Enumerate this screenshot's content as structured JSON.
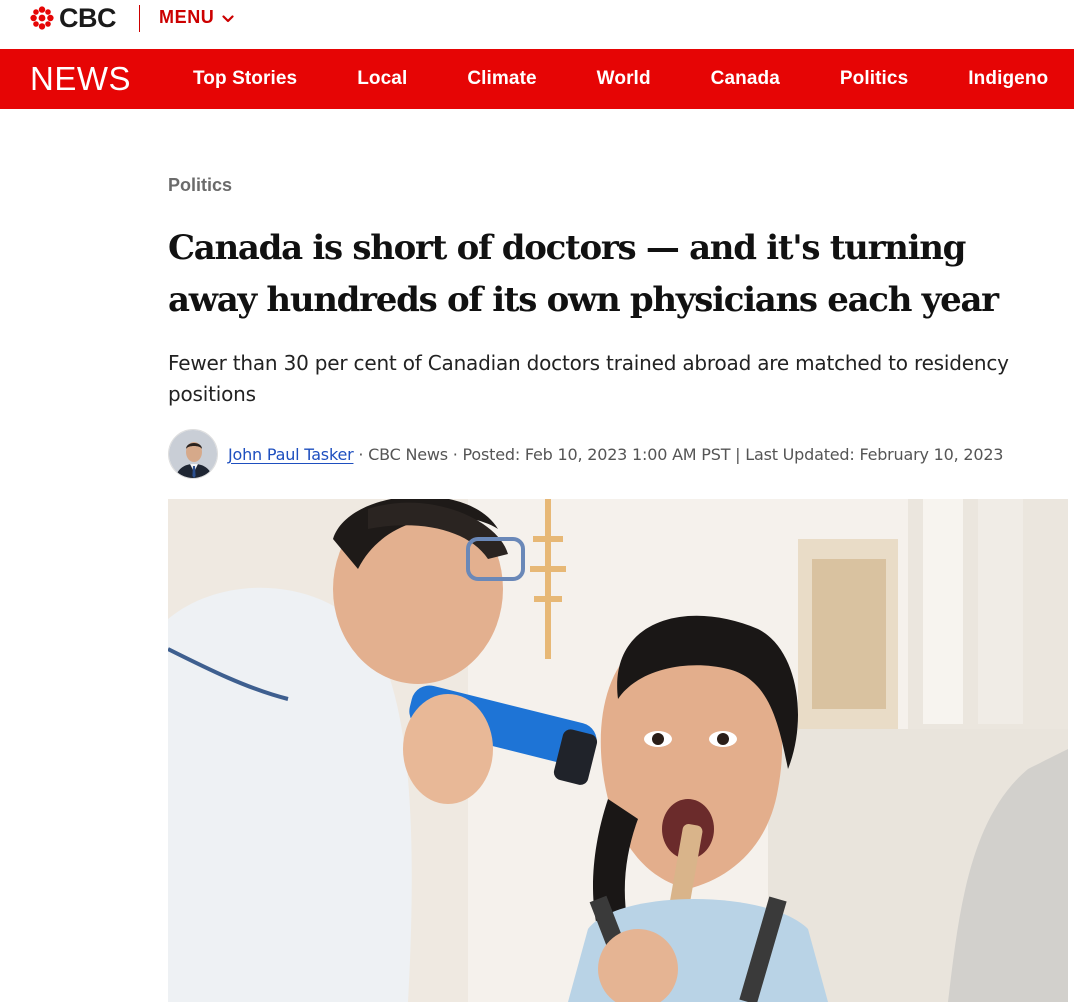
{
  "header": {
    "logo_text": "CBC",
    "menu_label": "MENU"
  },
  "nav": {
    "brand": "NEWS",
    "items": [
      "Top Stories",
      "Local",
      "Climate",
      "World",
      "Canada",
      "Politics",
      "Indigeno"
    ]
  },
  "article": {
    "section": "Politics",
    "headline": "Canada is short of doctors — and it's turning away hundreds of its own physicians each year",
    "deck": "Fewer than 30 per cent of Canadian doctors trained abroad are matched to residency positions",
    "byline": {
      "author": "John Paul Tasker",
      "outlet": " · CBC News · ",
      "posted": "Posted: Feb 10, 2023 1:00 AM PST",
      "separator": " | ",
      "updated": "Last Updated: February 10, 2023"
    }
  },
  "colors": {
    "brand_red": "#e60505",
    "menu_red": "#cc0000",
    "link_blue": "#1e4fbf"
  },
  "icons": {
    "logo": "cbc-gem-icon",
    "menu": "chevron-down-icon"
  }
}
